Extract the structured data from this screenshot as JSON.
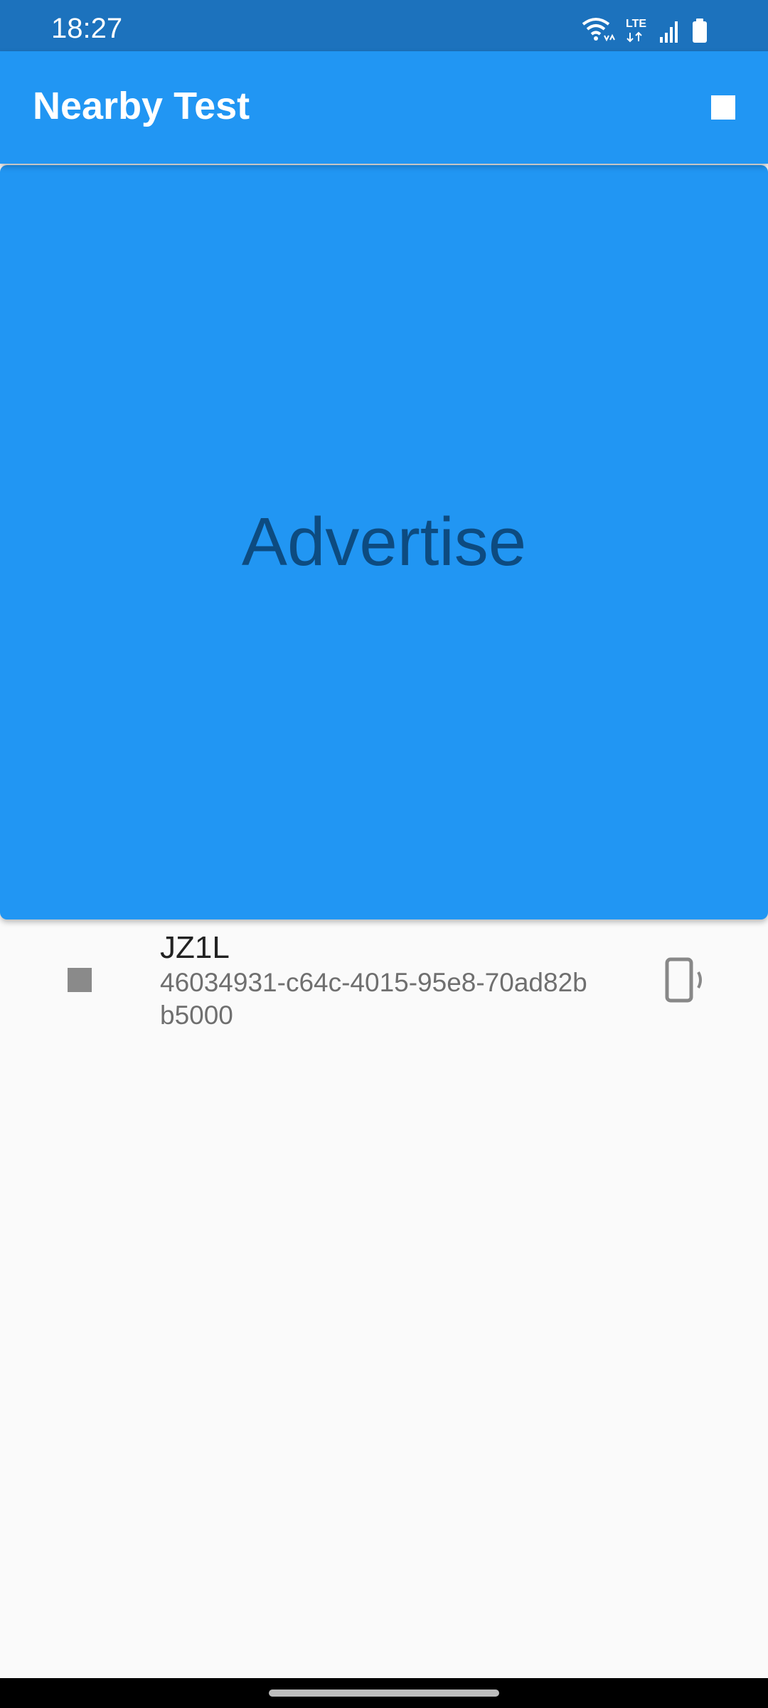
{
  "status_bar": {
    "time": "18:27",
    "icons": [
      "wifi-icon",
      "lte-icon",
      "signal-icon",
      "battery-icon"
    ],
    "network_label": "LTE"
  },
  "app_bar": {
    "title": "Nearby Test",
    "action_icon": "stop-icon",
    "color": "#2196f3"
  },
  "advertise": {
    "label": "Advertise",
    "color": "#2196f3",
    "text_color": "#0d4b80"
  },
  "devices": [
    {
      "name": "JZ1L",
      "id": "46034931-c64c-4015-95e8-70ad82bb5000",
      "leading_icon": "stop-icon",
      "trailing_icon": "phone-vibrate-icon"
    }
  ],
  "colors": {
    "status_bar": "#1c72bd",
    "background": "#fafafa"
  }
}
